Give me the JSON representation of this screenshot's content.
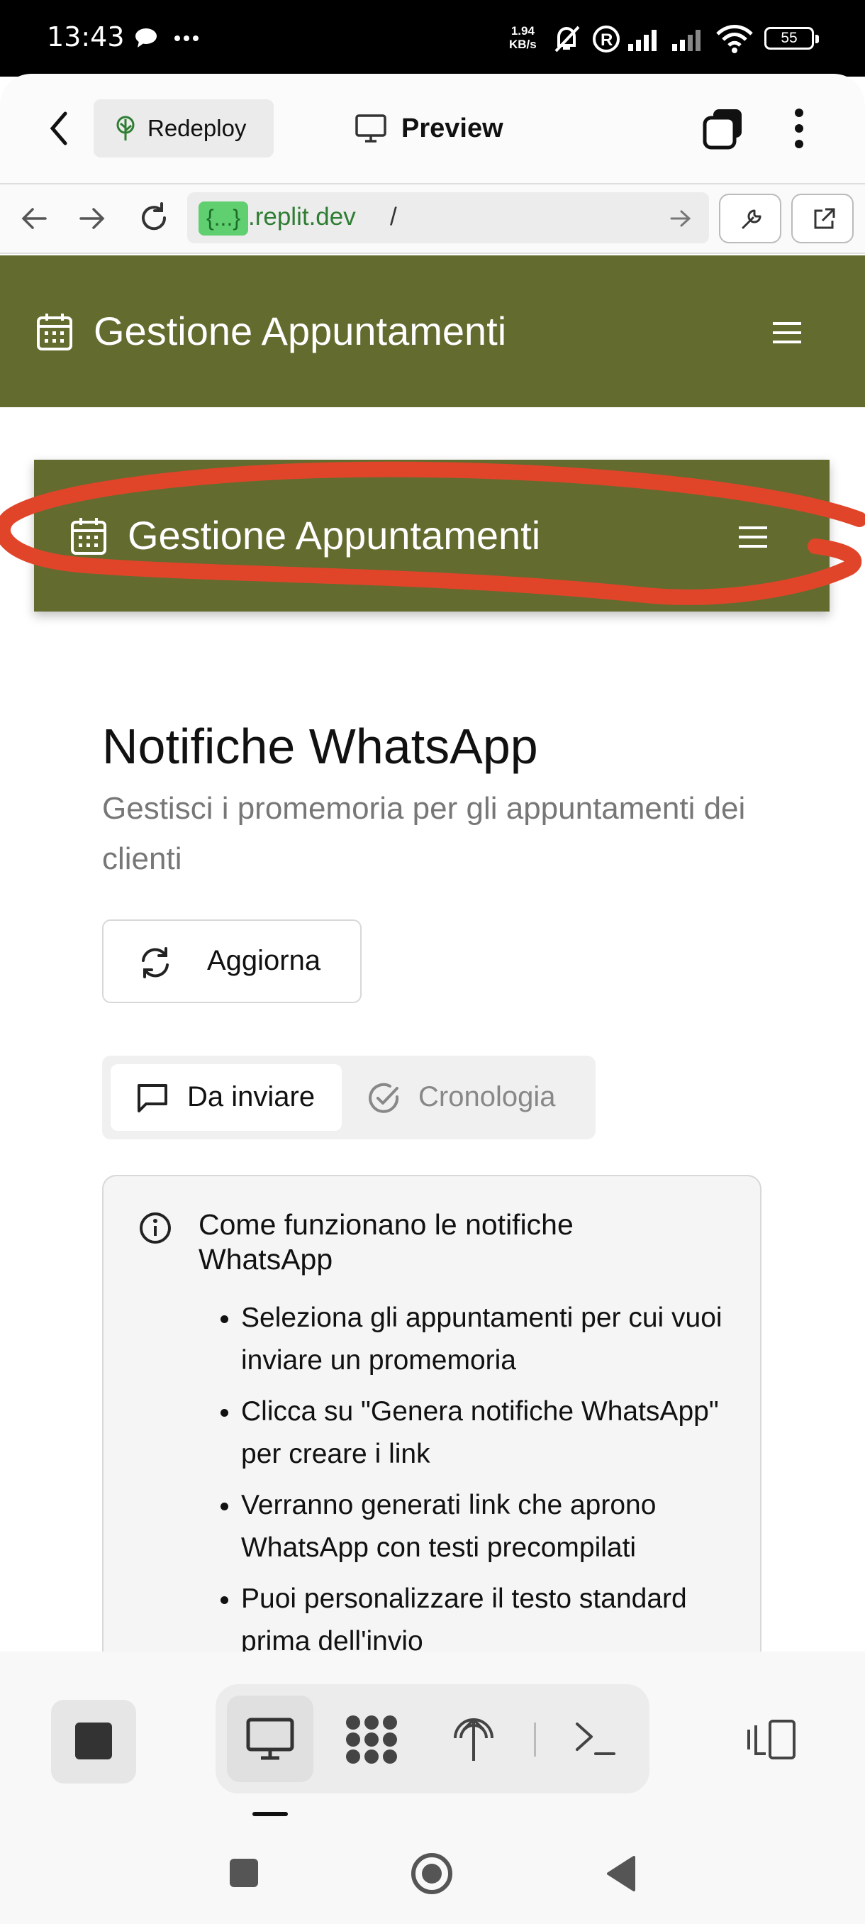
{
  "status_bar": {
    "time": "13:43",
    "net_speed_value": "1.94",
    "net_speed_unit": "KB/s",
    "battery": "55"
  },
  "app_header": {
    "redeploy_label": "Redeploy",
    "preview_label": "Preview"
  },
  "url_bar": {
    "chip": "{...}",
    "host": ".replit.dev",
    "path": "/"
  },
  "site_header": {
    "title": "Gestione Appuntamenti"
  },
  "inner_header": {
    "title": "Gestione Appuntamenti"
  },
  "page": {
    "title": "Notifiche WhatsApp",
    "subtitle": "Gestisci i promemoria per gli appuntamenti dei clienti",
    "refresh_label": "Aggiorna",
    "tabs": [
      {
        "label": "Da inviare",
        "active": true
      },
      {
        "label": "Cronologia",
        "active": false
      }
    ],
    "info": {
      "title": "Come funzionano le notifiche WhatsApp",
      "items": [
        "Seleziona gli appuntamenti per cui vuoi inviare un promemoria",
        "Clicca su \"Genera notifiche WhatsApp\" per creare i link",
        "Verranno generati link che aprono WhatsApp con testi precompilati",
        "Puoi personalizzare il testo standard prima dell'invio"
      ]
    }
  },
  "icons": [
    "back-icon",
    "tree-icon",
    "monitor-icon",
    "tabs-icon",
    "more-icon",
    "arrow-left-icon",
    "arrow-right-icon",
    "reload-icon",
    "go-icon",
    "wrench-icon",
    "external-link-icon",
    "calendar-icon",
    "hamburger-icon",
    "refresh-icon",
    "chat-icon",
    "check-circle-icon",
    "info-icon",
    "stop-icon",
    "workflow-icon",
    "deploy-icon",
    "terminal-icon",
    "devices-icon"
  ],
  "colors": {
    "header_green": "#636b2f",
    "url_chip": "#5fcf6f",
    "annotation_red": "#e0452a"
  }
}
